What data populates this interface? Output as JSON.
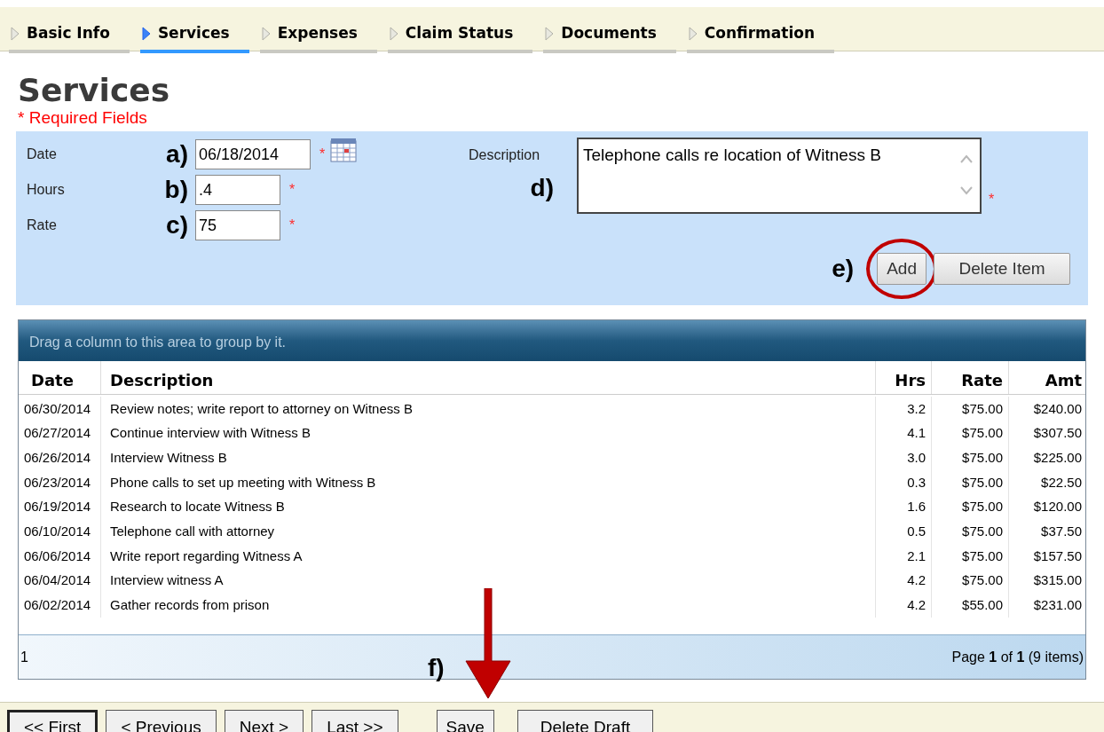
{
  "tabs": [
    {
      "label": "Basic Info",
      "selected": false
    },
    {
      "label": "Services",
      "selected": true
    },
    {
      "label": "Expenses",
      "selected": false
    },
    {
      "label": "Claim Status",
      "selected": false
    },
    {
      "label": "Documents",
      "selected": false
    },
    {
      "label": "Confirmation",
      "selected": false
    }
  ],
  "heading": "Services",
  "required_note": "* Required Fields",
  "form": {
    "fields": [
      {
        "label": "Date",
        "annotation": "a)",
        "value": "06/18/2014",
        "required_mark": "*",
        "calendar": true
      },
      {
        "label": "Hours",
        "annotation": "b)",
        "value": ".4",
        "required_mark": "*",
        "calendar": false
      },
      {
        "label": "Rate",
        "annotation": "c)",
        "value": "75",
        "required_mark": "*",
        "calendar": false
      }
    ],
    "description": {
      "label": "Description",
      "annotation": "d)",
      "value": "Telephone calls re location of Witness B",
      "required_mark": "*"
    },
    "buttons_annotation": "e)",
    "buttons": [
      {
        "label": "Add",
        "circled": true
      },
      {
        "label": "Delete Item",
        "circled": false
      }
    ]
  },
  "grid": {
    "group_hint": "Drag a column to this area to group by it.",
    "columns": [
      "Date",
      "Description",
      "Hrs",
      "Rate",
      "Amt"
    ],
    "rows": [
      [
        "06/30/2014",
        "Review notes; write report to attorney on Witness B",
        "3.2",
        "$75.00",
        "$240.00"
      ],
      [
        "06/27/2014",
        "Continue interview with Witness B",
        "4.1",
        "$75.00",
        "$307.50"
      ],
      [
        "06/26/2014",
        "Interview Witness B",
        "3.0",
        "$75.00",
        "$225.00"
      ],
      [
        "06/23/2014",
        "Phone calls to set up meeting with Witness B",
        "0.3",
        "$75.00",
        "$22.50"
      ],
      [
        "06/19/2014",
        "Research to locate Witness B",
        "1.6",
        "$75.00",
        "$120.00"
      ],
      [
        "06/10/2014",
        "Telephone call with attorney",
        "0.5",
        "$75.00",
        "$37.50"
      ],
      [
        "06/06/2014",
        "Write report regarding Witness A",
        "2.1",
        "$75.00",
        "$157.50"
      ],
      [
        "06/04/2014",
        "Interview witness A",
        "4.2",
        "$75.00",
        "$315.00"
      ],
      [
        "06/02/2014",
        "Gather records from prison",
        "4.2",
        "$55.00",
        "$231.00"
      ]
    ],
    "pager": {
      "page_link": "1",
      "summary": "Page **1** of **1** (9 items)"
    }
  },
  "save_annotation": "f)",
  "nav_buttons": [
    {
      "label": "<< First",
      "focused": true
    },
    {
      "label": "< Previous",
      "focused": false
    },
    {
      "label": "Next >",
      "focused": false
    },
    {
      "label": "Last >>",
      "focused": false
    }
  ],
  "action_buttons": [
    {
      "label": "Save",
      "arrow": true
    },
    {
      "label": "Delete Draft",
      "arrow": false
    }
  ]
}
